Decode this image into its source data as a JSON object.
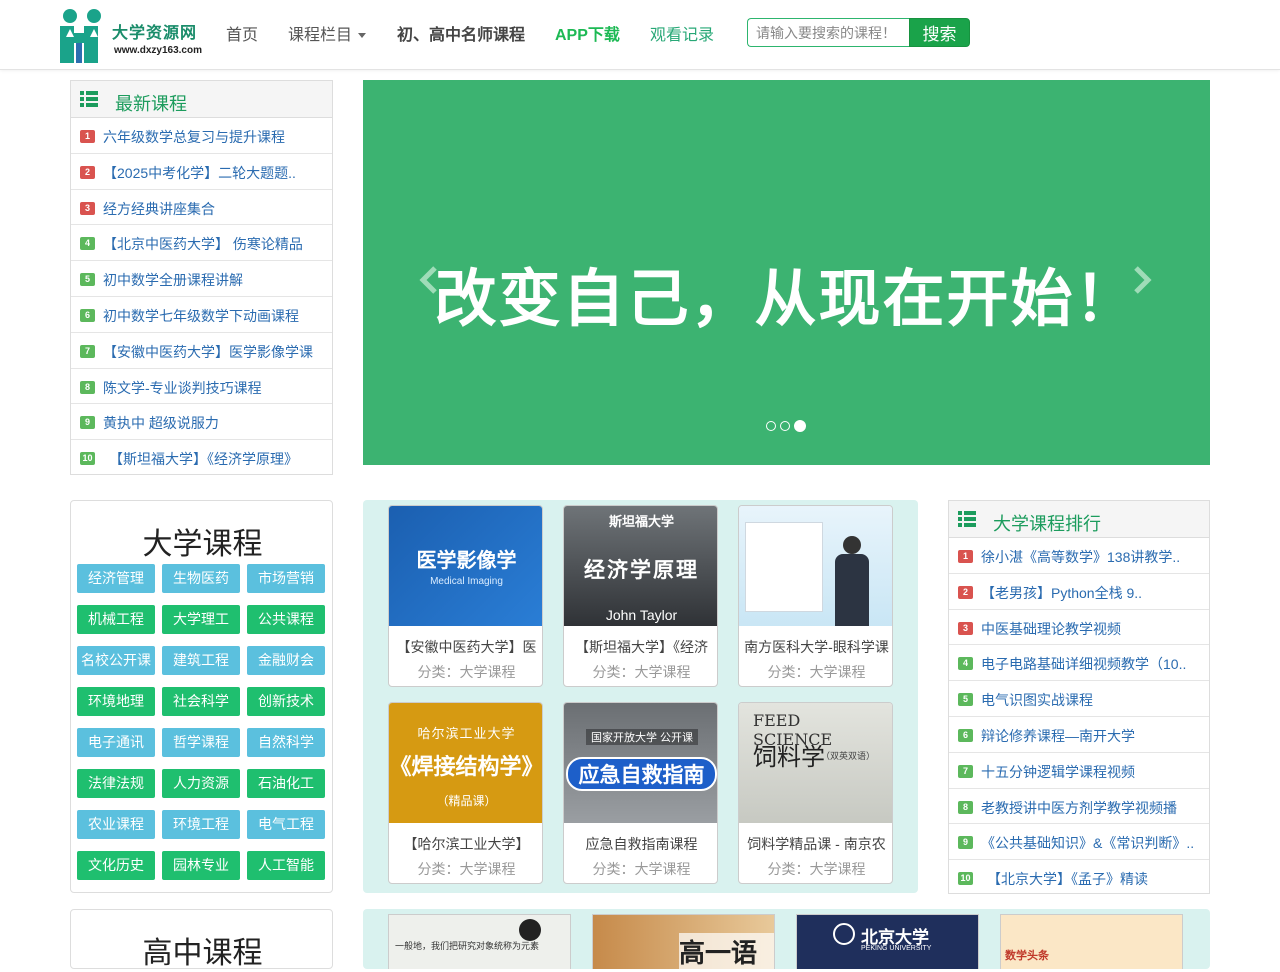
{
  "header": {
    "logo": {
      "title": "大学资源网",
      "url": "www.dxzy163.com"
    },
    "nav": [
      {
        "label": "首页"
      },
      {
        "label": "课程栏目"
      },
      {
        "label": "初、高中名师课程"
      },
      {
        "label": "APP下载"
      },
      {
        "label": "观看记录"
      }
    ],
    "search": {
      "placeholder": "请输入要搜索的课程！",
      "button": "搜索"
    }
  },
  "latest": {
    "title": "最新课程",
    "items": [
      {
        "rank": "1",
        "title": "六年级数学总复习与提升课程"
      },
      {
        "rank": "2",
        "title": "【2025中考化学】二轮大题题.."
      },
      {
        "rank": "3",
        "title": "经方经典讲座集合"
      },
      {
        "rank": "4",
        "title": "【北京中医药大学】 伤寒论精品"
      },
      {
        "rank": "5",
        "title": "初中数学全册课程讲解"
      },
      {
        "rank": "6",
        "title": "初中数学七年级数学下动画课程"
      },
      {
        "rank": "7",
        "title": "【安徽中医药大学】医学影像学课"
      },
      {
        "rank": "8",
        "title": "陈文学-专业谈判技巧课程"
      },
      {
        "rank": "9",
        "title": "黄执中 超级说服力"
      },
      {
        "rank": "10",
        "title": "【斯坦福大学】《经济学原理》"
      }
    ]
  },
  "carousel": {
    "slogan": "改变自己，从现在开始！",
    "slide_count": 3,
    "active_slide": 3
  },
  "categories": {
    "title": "大学课程",
    "items": [
      "经济管理",
      "生物医药",
      "市场营销",
      "机械工程",
      "大学理工",
      "公共课程",
      "名校公开课",
      "建筑工程",
      "金融财会",
      "环境地理",
      "社会科学",
      "创新技术",
      "电子通讯",
      "哲学课程",
      "自然科学",
      "法律法规",
      "人力资源",
      "石油化工",
      "农业课程",
      "环境工程",
      "电气工程",
      "文化历史",
      "园林专业",
      "人工智能"
    ]
  },
  "courses": [
    {
      "name": "【安徽中医药大学】医",
      "category": "分类：大学课程",
      "thumb_title": "医学影像学",
      "thumb_sub": "Medical Imaging"
    },
    {
      "name": "【斯坦福大学】《经济",
      "category": "分类：大学课程",
      "thumb_top": "斯坦福大学",
      "thumb_title": "经济学原理",
      "thumb_sub": "John Taylor"
    },
    {
      "name": "南方医科大学-眼科学课",
      "category": "分类：大学课程"
    },
    {
      "name": "【哈尔滨工业大学】",
      "category": "分类：大学课程",
      "thumb_top": "哈尔滨工业大学",
      "thumb_title": "《焊接结构学》",
      "thumb_sub": "（精品课）"
    },
    {
      "name": "应急自救指南课程",
      "category": "分类：大学课程",
      "thumb_top": "国家开放大学 公开课",
      "thumb_title": "应急自救指南"
    },
    {
      "name": "饲料学精品课 - 南京农",
      "category": "分类：大学课程",
      "thumb_top": "FEED SCIENCE",
      "thumb_title": "饲料学",
      "thumb_sub": "（双英双语）"
    }
  ],
  "ranking": {
    "title": "大学课程排行",
    "items": [
      {
        "rank": "1",
        "title": "徐小湛《高等数学》138讲教学.."
      },
      {
        "rank": "2",
        "title": "【老男孩】Python全栈 9.."
      },
      {
        "rank": "3",
        "title": "中医基础理论教学视频"
      },
      {
        "rank": "4",
        "title": "电子电路基础详细视频教学（10.."
      },
      {
        "rank": "5",
        "title": "电气识图实战课程"
      },
      {
        "rank": "6",
        "title": "辩论修养课程—南开大学"
      },
      {
        "rank": "7",
        "title": "十五分钟逻辑学课程视频"
      },
      {
        "rank": "8",
        "title": "老教授讲中医方剂学教学视频播"
      },
      {
        "rank": "9",
        "title": "《公共基础知识》&《常识判断》.."
      },
      {
        "rank": "10",
        "title": "【北京大学】《孟子》精读"
      }
    ]
  },
  "highschool": {
    "title": "高中课程",
    "thumbs": [
      {
        "text": "一般地，我们把研究对象统称为元素"
      },
      {
        "text": "高一语文"
      },
      {
        "text": "北京大学",
        "sub": "PEKING UNIVERSITY"
      },
      {
        "text": "数学头条"
      }
    ]
  },
  "colors": {
    "accent": "#3cb371",
    "link": "#2a6bb0",
    "badge_red": "#d9534f",
    "badge_green": "#5cb85c",
    "cat_blue": "#5bc0de",
    "cat_green": "#1fbf6f"
  }
}
